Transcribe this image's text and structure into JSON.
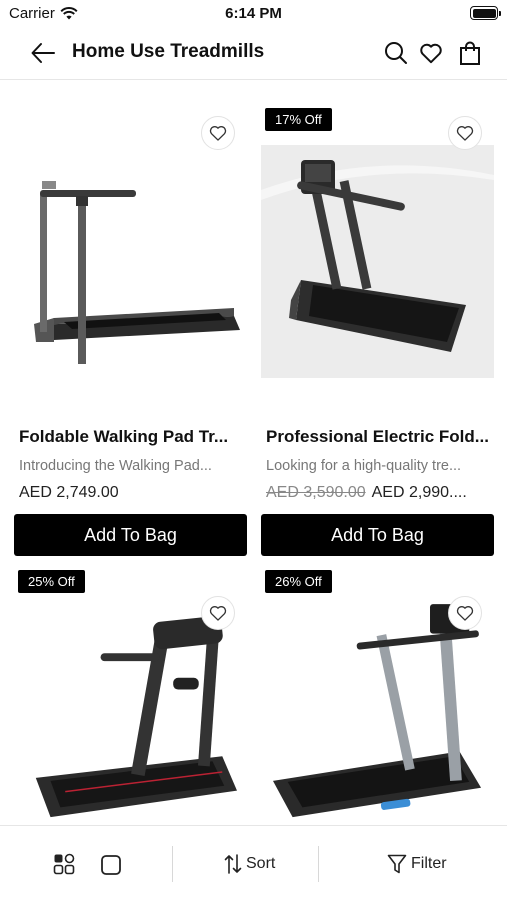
{
  "status_bar": {
    "carrier": "Carrier",
    "time": "6:14 PM"
  },
  "header": {
    "title": "Home Use Treadmills"
  },
  "products": [
    {
      "name": "Foldable Walking Pad Tr...",
      "description": "Introducing the Walking Pad...",
      "old_price": "",
      "price": "AED 2,749.00",
      "badge": "",
      "button_label": "Add To Bag"
    },
    {
      "name": "Professional Electric Fold...",
      "description": "Looking for a high-quality tre...",
      "old_price": "AED 3,590.00",
      "price": "AED 2,990....",
      "badge": "17% Off",
      "button_label": "Add To Bag"
    },
    {
      "name": "",
      "description": "",
      "old_price": "",
      "price": "",
      "badge": "25% Off",
      "button_label": ""
    },
    {
      "name": "",
      "description": "",
      "old_price": "",
      "price": "",
      "badge": "26% Off",
      "button_label": ""
    }
  ],
  "bottom_bar": {
    "sort_label": "Sort",
    "filter_label": "Filter"
  },
  "icons": {
    "back": "arrow-left-icon",
    "search": "search-icon",
    "wishlist": "heart-icon",
    "bag": "shopping-bag-icon",
    "grid_view": "grid-view-icon",
    "single_view": "single-view-icon",
    "sort": "sort-icon",
    "filter": "filter-icon"
  },
  "colors": {
    "accent": "#000000",
    "muted_text": "#777777",
    "border": "#e6e6e6"
  }
}
